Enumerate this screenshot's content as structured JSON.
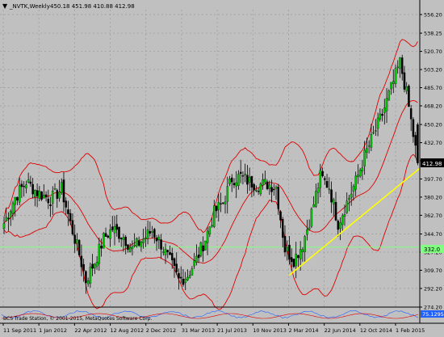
{
  "header": {
    "symbol_label": "_NVTK,Weekly",
    "ohlc": "450.18 451.98 410.88 412.98"
  },
  "price_axis": {
    "ticks": [
      "556.20",
      "538.25",
      "520.70",
      "503.20",
      "485.70",
      "468.20",
      "450.20",
      "432.70",
      "415.20",
      "397.70",
      "380.20",
      "362.70",
      "344.70",
      "327.20",
      "309.70",
      "292.20",
      "274.20"
    ],
    "current_price": "412.98",
    "level_label": "332.0"
  },
  "time_axis": {
    "labels": [
      "11 Sep 2011",
      "1 Jan 2012",
      "22 Apr 2012",
      "12 Aug 2012",
      "2 Dec 2012",
      "31 Mar 2013",
      "21 Jul 2013",
      "10 Nov 2013",
      "2 Mar 2014",
      "22 Jun 2014",
      "12 Oct 2014",
      "1 Feb 2015"
    ]
  },
  "indicator": {
    "value_label": "75.1295",
    "copyright": "BCS Trade Station, © 2001-2015, MetaQuotes Software Corp."
  },
  "colors": {
    "background": "#c0c0c0",
    "grid": "#9a9a9a",
    "bull_candle": "#00cc00",
    "bear_candle": "#000000",
    "bands": "#e00000",
    "trendline": "#ffff00",
    "level_line": "#80ff80",
    "current_price_bg": "#000000"
  },
  "chart_data": {
    "type": "candlestick",
    "title": "_NVTK,Weekly",
    "ohlc_last": {
      "open": 450.18,
      "high": 451.98,
      "low": 410.88,
      "close": 412.98
    },
    "ylim": [
      274.2,
      556.2
    ],
    "x_start": "11 Sep 2011",
    "x_end": "1 Feb 2015",
    "close_path": [
      {
        "date": "2011-09-11",
        "close": 355
      },
      {
        "date": "2011-10-16",
        "close": 380
      },
      {
        "date": "2011-11-20",
        "close": 395
      },
      {
        "date": "2011-12-25",
        "close": 385
      },
      {
        "date": "2012-02-05",
        "close": 378
      },
      {
        "date": "2012-03-11",
        "close": 388
      },
      {
        "date": "2012-04-08",
        "close": 355
      },
      {
        "date": "2012-05-06",
        "close": 325
      },
      {
        "date": "2012-05-27",
        "close": 300
      },
      {
        "date": "2012-06-24",
        "close": 318
      },
      {
        "date": "2012-07-22",
        "close": 340
      },
      {
        "date": "2012-08-19",
        "close": 350
      },
      {
        "date": "2012-09-23",
        "close": 342
      },
      {
        "date": "2012-10-21",
        "close": 330
      },
      {
        "date": "2012-11-25",
        "close": 340
      },
      {
        "date": "2012-12-23",
        "close": 348
      },
      {
        "date": "2013-01-20",
        "close": 335
      },
      {
        "date": "2013-02-17",
        "close": 318
      },
      {
        "date": "2013-03-17",
        "close": 300
      },
      {
        "date": "2013-04-14",
        "close": 305
      },
      {
        "date": "2013-05-12",
        "close": 320
      },
      {
        "date": "2013-06-09",
        "close": 340
      },
      {
        "date": "2013-07-07",
        "close": 365
      },
      {
        "date": "2013-08-04",
        "close": 375
      },
      {
        "date": "2013-09-01",
        "close": 398
      },
      {
        "date": "2013-09-29",
        "close": 400
      },
      {
        "date": "2013-10-27",
        "close": 395
      },
      {
        "date": "2013-11-24",
        "close": 392
      },
      {
        "date": "2013-12-22",
        "close": 393
      },
      {
        "date": "2014-01-19",
        "close": 390
      },
      {
        "date": "2014-02-16",
        "close": 330
      },
      {
        "date": "2014-03-16",
        "close": 320
      },
      {
        "date": "2014-04-13",
        "close": 335
      },
      {
        "date": "2014-05-11",
        "close": 365
      },
      {
        "date": "2014-06-08",
        "close": 400
      },
      {
        "date": "2014-07-06",
        "close": 390
      },
      {
        "date": "2014-08-03",
        "close": 355
      },
      {
        "date": "2014-08-31",
        "close": 375
      },
      {
        "date": "2014-09-28",
        "close": 395
      },
      {
        "date": "2014-10-26",
        "close": 420
      },
      {
        "date": "2014-11-23",
        "close": 440
      },
      {
        "date": "2014-12-21",
        "close": 460
      },
      {
        "date": "2015-01-18",
        "close": 485
      },
      {
        "date": "2015-02-15",
        "close": 510
      },
      {
        "date": "2015-03-08",
        "close": 480
      },
      {
        "date": "2015-03-29",
        "close": 440
      },
      {
        "date": "2015-04-12",
        "close": 413
      }
    ],
    "indicators": [
      "Bollinger Bands (red)",
      "Support trendline (yellow)",
      "Horizontal level (green) at 332.0",
      "Oscillator subwindow"
    ]
  }
}
